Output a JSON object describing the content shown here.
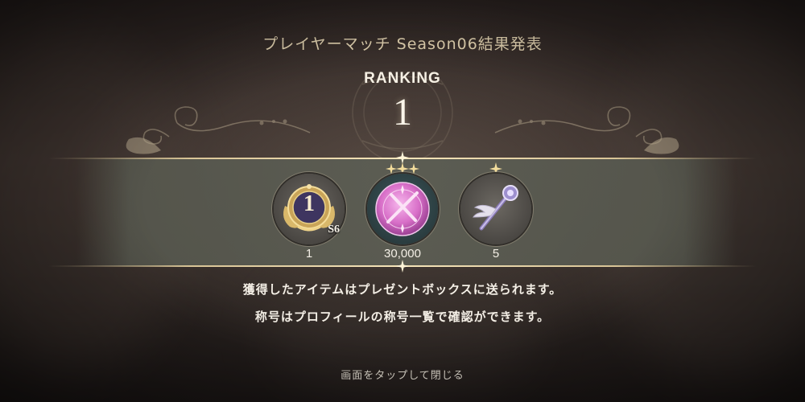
{
  "header": {
    "title": "プレイヤーマッチ Season06結果発表"
  },
  "ranking": {
    "label": "RANKING",
    "value": "1"
  },
  "rewards": [
    {
      "icon": "rank-1-medal-icon",
      "badge_number": "1",
      "badge_season": "S6",
      "count": "1",
      "stars": 0,
      "accent": "#d9b86a"
    },
    {
      "icon": "pink-crystal-orb-icon",
      "count": "30,000",
      "stars": 3,
      "accent": "#d86fc8"
    },
    {
      "icon": "winged-staff-icon",
      "count": "5",
      "stars": 1,
      "accent": "#9d8fcf"
    }
  ],
  "messages": [
    "獲得したアイテムはプレゼントボックスに送られます。",
    "称号はプロフィールの称号一覧で確認ができます。"
  ],
  "footer": {
    "close_hint": "画面をタップして閉じる"
  },
  "colors": {
    "gold": "#e9d9b6",
    "band": "#5c5e54",
    "text": "#f4efe6"
  }
}
